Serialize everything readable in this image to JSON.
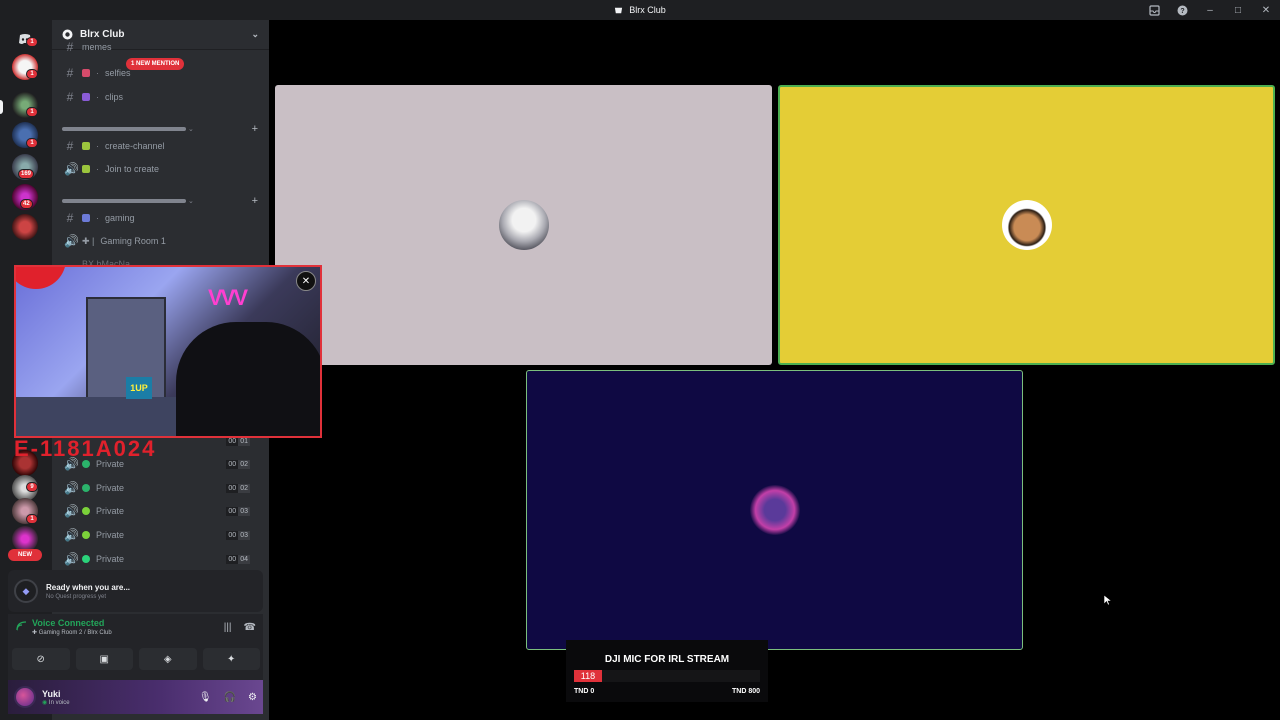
{
  "window": {
    "title": "Blrx Club"
  },
  "titlebar_icons": [
    "inbox-icon",
    "help-icon",
    "minimize-icon",
    "maximize-icon",
    "close-icon"
  ],
  "server_rail": {
    "badges": [
      {
        "label": "1"
      },
      {
        "label": "1"
      },
      {
        "label": "1"
      },
      {
        "label": "1"
      },
      {
        "label": "169"
      },
      {
        "label": "42"
      },
      {
        "label": "9"
      },
      {
        "label": "1"
      }
    ],
    "new_label": "NEW"
  },
  "guild": {
    "name": "Blrx Club"
  },
  "channels": {
    "partial_top": "memes",
    "selfies": "selfies",
    "mention_label": "1 NEW MENTION",
    "clips": "clips",
    "create_channel": "create-channel",
    "join_to_create": "Join to create",
    "gaming": "gaming",
    "gaming_room_1": "Gaming Room 1",
    "partial_user": "BX bMacNa",
    "private_rows": [
      {
        "label": "Private",
        "a": "00",
        "b": "02"
      },
      {
        "label": "Private",
        "a": "00",
        "b": "02"
      },
      {
        "label": "Private",
        "a": "00",
        "b": "03"
      },
      {
        "label": "Private",
        "a": "00",
        "b": "03"
      },
      {
        "label": "Private",
        "a": "00",
        "b": "04"
      }
    ],
    "hidden_count": {
      "a": "00",
      "b": "01"
    }
  },
  "quest": {
    "title": "Ready when you are...",
    "subtitle": "No Quest progress yet"
  },
  "voice": {
    "status": "Voice Connected",
    "location": "Gaming Room 2 / Blrx Club"
  },
  "user": {
    "name": "Yuki",
    "status": "In voice"
  },
  "tiles": {
    "colors": {
      "tile1": "#c9bfc5",
      "tile2": "#e4cd36",
      "tile3": "#0f0943",
      "speaking_border": "#4caf50"
    }
  },
  "overlay": {
    "webcam_sign": "VVV",
    "webcam_desk_label": "1UP",
    "red_banner": "E-1181A024"
  },
  "goal": {
    "title": "DJI MIC FOR IRL STREAM",
    "current": "118",
    "min_label": "TND 0",
    "max_label": "TND 800",
    "progress": 0.15
  },
  "colors": {
    "accent_red": "#e0313a",
    "voice_green": "#23a55a"
  }
}
